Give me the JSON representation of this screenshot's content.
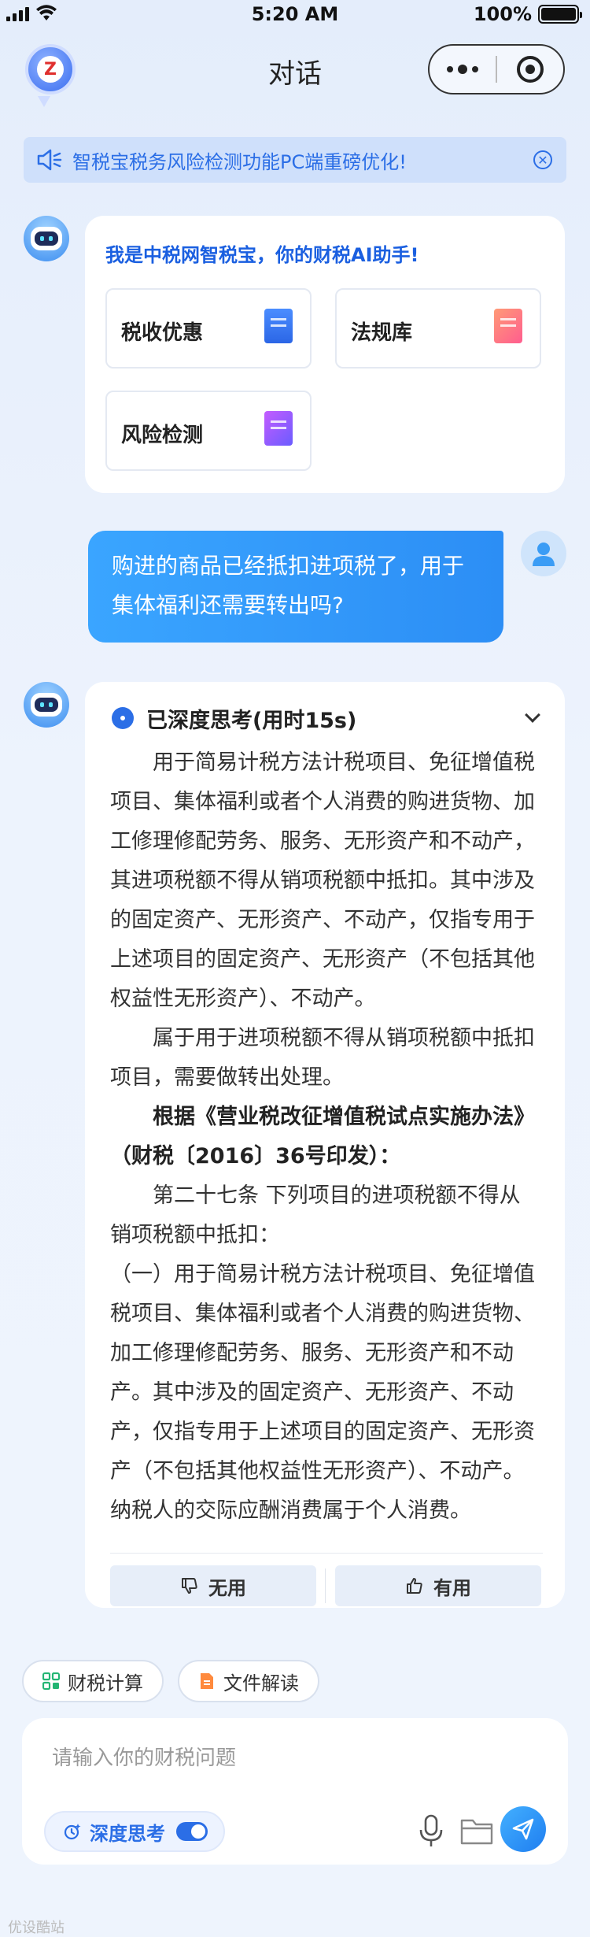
{
  "status_bar": {
    "time": "5:20 AM",
    "battery": "100%"
  },
  "nav": {
    "title": "对话"
  },
  "notice": {
    "text": "智税宝税务风险检测功能PC端重磅优化!"
  },
  "welcome": {
    "title": "我是中税网智税宝，你的财税AI助手!",
    "quick_actions": [
      {
        "label": "税收优惠",
        "icon": "blue-doc-icon"
      },
      {
        "label": "法规库",
        "icon": "pink-doc-icon"
      },
      {
        "label": "风险检测",
        "icon": "purple-book-icon"
      }
    ]
  },
  "user_message": {
    "text": "购进的商品已经抵扣进项税了，用于集体福利还需要转出吗?"
  },
  "answer": {
    "thinking_label": "已深度思考(用时15s)",
    "paragraphs": [
      "用于简易计税方法计税项目、免征增值税项目、集体福利或者个人消费的购进货物、加工修理修配劳务、服务、无形资产和不动产，其进项税额不得从销项税额中抵扣。其中涉及的固定资产、无形资产、不动产，仅指专用于上述项目的固定资产、无形资产（不包括其他权益性无形资产）、不动产。",
      "属于用于进项税额不得从销项税额中抵扣项目，需要做转出处理。",
      "根据《营业税改征增值税试点实施办法》（财税〔2016〕36号印发）：",
      "第二十七条 下列项目的进项税额不得从销项税额中抵扣：",
      "（一）用于简易计税方法计税项目、免征增值税项目、集体福利或者个人消费的购进货物、加工修理修配劳务、服务、无形资产和不动产。其中涉及的固定资产、无形资产、不动产，仅指专用于上述项目的固定资产、无形资产（不包括其他权益性无形资产）、不动产。纳税人的交际应酬消费属于个人消费。"
    ],
    "feedback_no": "无用",
    "feedback_yes": "有用"
  },
  "chips": [
    {
      "label": "财税计算",
      "icon": "grid-icon"
    },
    {
      "label": "文件解读",
      "icon": "file-icon"
    }
  ],
  "input": {
    "placeholder": "请输入你的财税问题",
    "deep_think_label": "深度思考"
  },
  "watermark": "优设酷站",
  "colors": {
    "accent": "#2b6ee6",
    "bubble": "#3aa5ff"
  }
}
